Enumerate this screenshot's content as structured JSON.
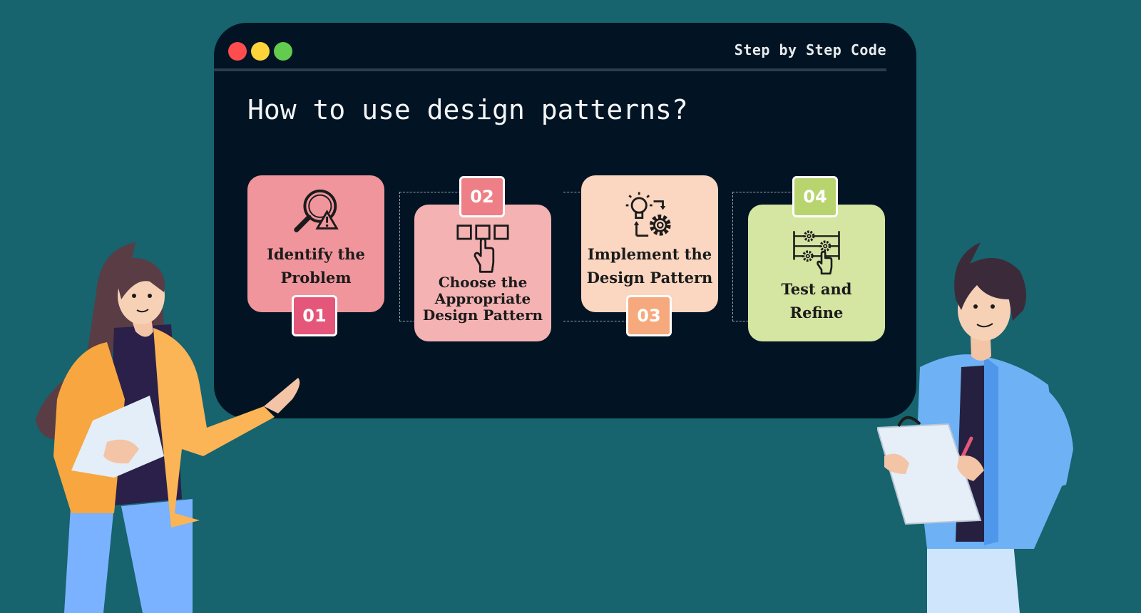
{
  "window": {
    "brand": "Step by Step Code",
    "heading": "How to use design patterns?",
    "dot_colors": [
      "#ff4d4f",
      "#ffd43b",
      "#63cc4e"
    ]
  },
  "steps": [
    {
      "number": "01",
      "label_lines": [
        "Identify the",
        "Problem"
      ],
      "icon": "magnifier-warning-icon",
      "card_color": "#f1959c",
      "badge_color": "#e4577a"
    },
    {
      "number": "02",
      "label_lines": [
        "Choose the",
        "Appropriate",
        "Design Pattern"
      ],
      "icon": "hand-select-boxes-icon",
      "card_color": "#f5b2b3",
      "badge_color": "#ee7f86"
    },
    {
      "number": "03",
      "label_lines": [
        "Implement the",
        "Design Pattern"
      ],
      "icon": "lightbulb-gear-icon",
      "card_color": "#fbd6c1",
      "badge_color": "#f6a97c"
    },
    {
      "number": "04",
      "label_lines": [
        "Test and",
        "Refine"
      ],
      "icon": "gears-hand-icon",
      "card_color": "#d5e5a2",
      "badge_color": "#b8d46f"
    }
  ]
}
